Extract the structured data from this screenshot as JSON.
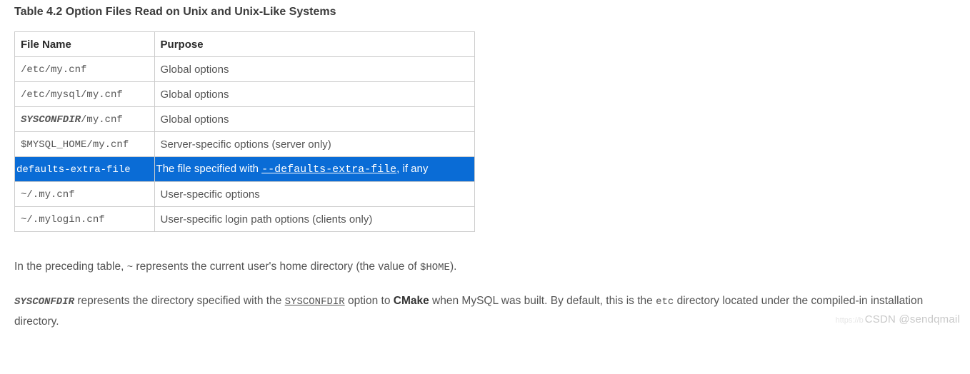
{
  "title": "Table 4.2 Option Files Read on Unix and Unix-Like Systems",
  "table": {
    "headers": {
      "col1": "File Name",
      "col2": "Purpose"
    },
    "rows": [
      {
        "file_pre": "",
        "file_mono": "/etc/my.cnf",
        "purpose_a": "Global options",
        "link": "",
        "purpose_b": ""
      },
      {
        "file_pre": "",
        "file_mono": "/etc/mysql/my.cnf",
        "purpose_a": "Global options",
        "link": "",
        "purpose_b": ""
      },
      {
        "file_pre": "SYSCONFDIR",
        "file_mono": "/my.cnf",
        "purpose_a": "Global options",
        "link": "",
        "purpose_b": ""
      },
      {
        "file_pre": "",
        "file_mono": "$MYSQL_HOME/my.cnf",
        "purpose_a": "Server-specific options (server only)",
        "link": "",
        "purpose_b": ""
      },
      {
        "file_pre": "",
        "file_mono": "defaults-extra-file",
        "purpose_a": "The file specified with ",
        "link": "--defaults-extra-file",
        "purpose_b": ", if any"
      },
      {
        "file_pre": "",
        "file_mono": "~/.my.cnf",
        "purpose_a": "User-specific options",
        "link": "",
        "purpose_b": ""
      },
      {
        "file_pre": "",
        "file_mono": "~/.mylogin.cnf",
        "purpose_a": "User-specific login path options (clients only)",
        "link": "",
        "purpose_b": ""
      }
    ]
  },
  "para1": {
    "a": "In the preceding table, ",
    "tilde": "~",
    "b": " represents the current user's home directory (the value of ",
    "home": "$HOME",
    "c": ")."
  },
  "para2": {
    "sysconfdir": "SYSCONFDIR",
    "a": " represents the directory specified with the ",
    "opt": "SYSCONFDIR",
    "b": " option to ",
    "cmake": "CMake",
    "c": " when MySQL was built. By default, this is the ",
    "etc": "etc",
    "d": " directory located under the compiled-in installation directory."
  },
  "watermark": {
    "faded": "https://b",
    "main": "CSDN @sendqmail"
  }
}
